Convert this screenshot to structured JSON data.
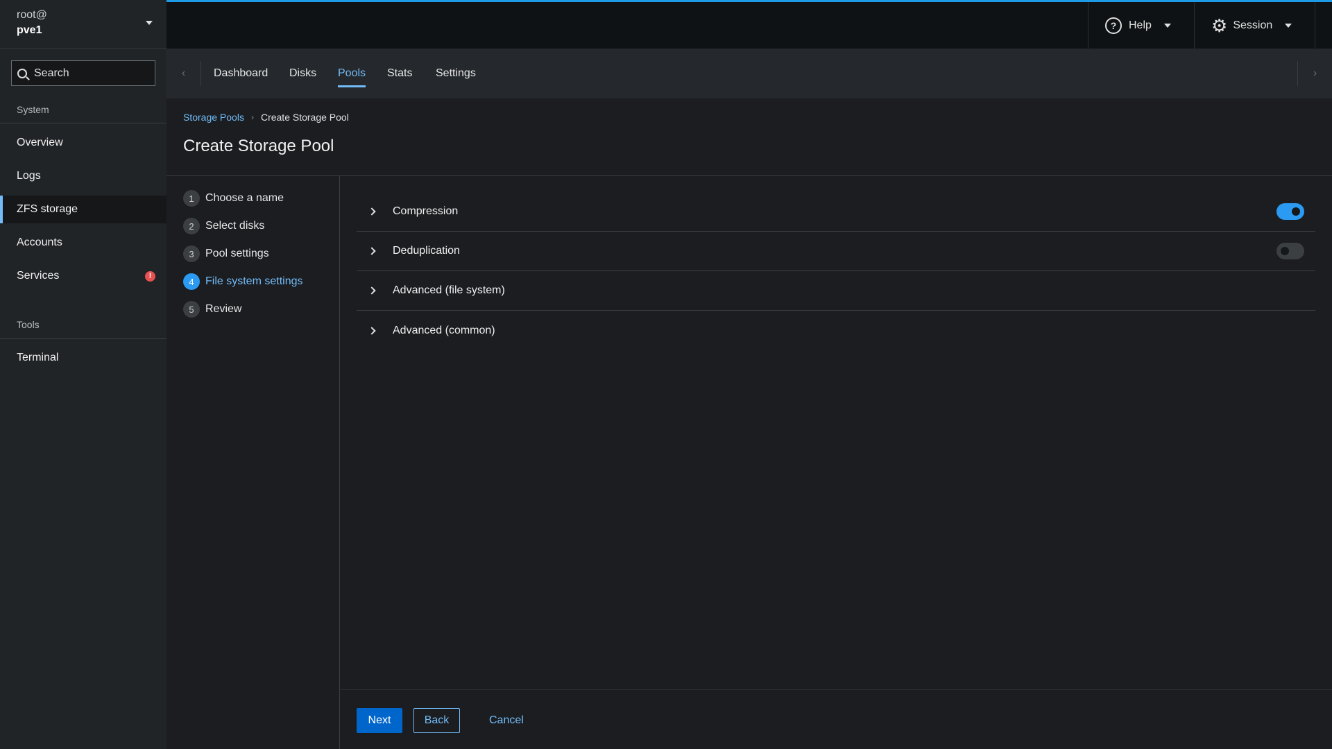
{
  "sidebar": {
    "host_user": "root@",
    "host_name": "pve1",
    "search_placeholder": "Search",
    "system_label": "System",
    "tools_label": "Tools",
    "items": [
      {
        "label": "Overview"
      },
      {
        "label": "Logs"
      },
      {
        "label": "ZFS storage"
      },
      {
        "label": "Accounts"
      },
      {
        "label": "Services",
        "badge": "!"
      },
      {
        "label": "Terminal"
      }
    ]
  },
  "masthead": {
    "help_label": "Help",
    "session_label": "Session"
  },
  "tabs": [
    {
      "label": "Dashboard"
    },
    {
      "label": "Disks"
    },
    {
      "label": "Pools"
    },
    {
      "label": "Stats"
    },
    {
      "label": "Settings"
    }
  ],
  "breadcrumb": {
    "parent": "Storage Pools",
    "current": "Create Storage Pool"
  },
  "page_title": "Create Storage Pool",
  "wizard": {
    "steps": [
      {
        "num": "1",
        "label": "Choose a name"
      },
      {
        "num": "2",
        "label": "Select disks"
      },
      {
        "num": "3",
        "label": "Pool settings"
      },
      {
        "num": "4",
        "label": "File system settings"
      },
      {
        "num": "5",
        "label": "Review"
      }
    ],
    "sections": [
      {
        "label": "Compression",
        "toggle": true
      },
      {
        "label": "Deduplication",
        "toggle": false
      },
      {
        "label": "Advanced (file system)"
      },
      {
        "label": "Advanced (common)"
      }
    ],
    "next_label": "Next",
    "back_label": "Back",
    "cancel_label": "Cancel"
  },
  "colors": {
    "accent": "#73bcf7",
    "primary": "#0066cc",
    "alert": "#e85151"
  }
}
